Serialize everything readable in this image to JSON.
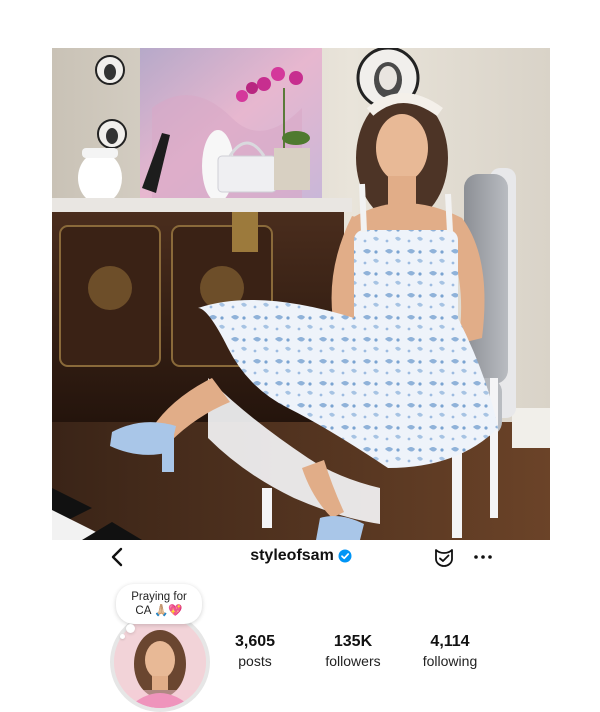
{
  "header": {
    "username": "styleofsam",
    "verified": true,
    "icons": [
      "back-icon",
      "verified-badge-icon",
      "threads-icon",
      "more-icon"
    ]
  },
  "note": {
    "text_line1": "Praying for",
    "text_line2": "CA 🙏🏼💖"
  },
  "stats": {
    "posts": {
      "value": "3,605",
      "label": "posts"
    },
    "followers": {
      "value": "135K",
      "label": "followers"
    },
    "following": {
      "value": "4,114",
      "label": "following"
    }
  },
  "colors": {
    "verified_blue": "#0095f6",
    "text": "#111111"
  }
}
